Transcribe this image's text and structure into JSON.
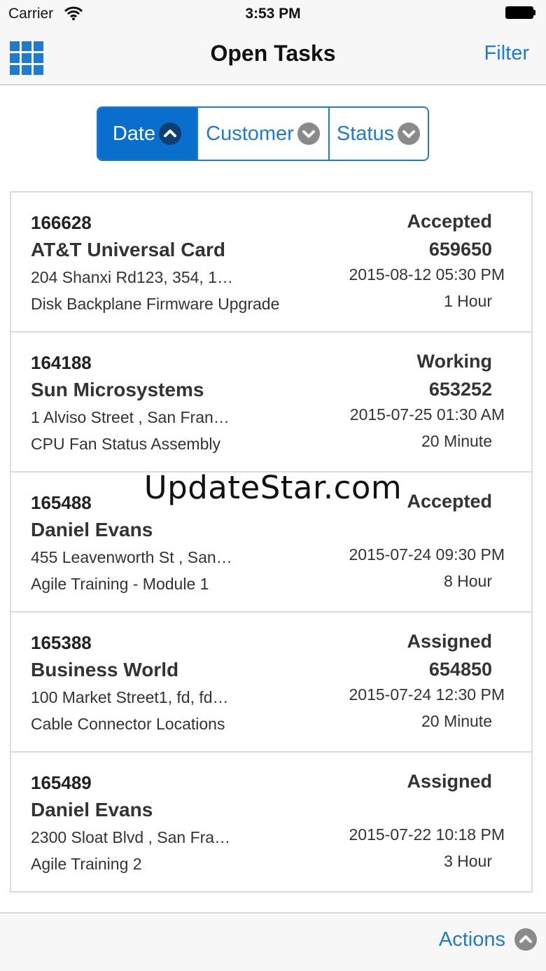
{
  "status_bar": {
    "carrier": "Carrier",
    "time": "3:53 PM"
  },
  "nav": {
    "title": "Open Tasks",
    "filter_label": "Filter"
  },
  "sort": {
    "segments": [
      {
        "label": "Date",
        "active": true,
        "direction": "up"
      },
      {
        "label": "Customer",
        "active": false,
        "direction": "down"
      },
      {
        "label": "Status",
        "active": false,
        "direction": "down"
      }
    ]
  },
  "tasks": [
    {
      "id": "166628",
      "customer": "AT&T Universal Card",
      "address": "204 Shanxi Rd123, 354, 1…",
      "description": "Disk Backplane Firmware Upgrade",
      "status": "Accepted",
      "number": "659650",
      "datetime": "2015-08-12 05:30 PM",
      "duration": "1 Hour"
    },
    {
      "id": "164188",
      "customer": "Sun Microsystems",
      "address": "1 Alviso Street , San Fran…",
      "description": "CPU Fan Status Assembly",
      "status": "Working",
      "number": "653252",
      "datetime": "2015-07-25 01:30 AM",
      "duration": "20 Minute"
    },
    {
      "id": "165488",
      "customer": "Daniel Evans",
      "address": "455 Leavenworth St , San…",
      "description": "Agile Training - Module 1",
      "status": "Accepted",
      "number": "",
      "datetime": "2015-07-24 09:30 PM",
      "duration": "8 Hour"
    },
    {
      "id": "165388",
      "customer": "Business World",
      "address": "100 Market Street1, fd, fd…",
      "description": "Cable Connector Locations",
      "status": "Assigned",
      "number": "654850",
      "datetime": "2015-07-24 12:30 PM",
      "duration": "20 Minute"
    },
    {
      "id": "165489",
      "customer": "Daniel Evans",
      "address": "2300 Sloat Blvd , San Fra…",
      "description": "Agile Training 2",
      "status": "Assigned",
      "number": "",
      "datetime": "2015-07-22 10:18 PM",
      "duration": "3 Hour"
    }
  ],
  "watermark": "UpdateStar.com",
  "footer": {
    "actions_label": "Actions"
  },
  "colors": {
    "accent": "#1f7bd0",
    "active_segment": "#0a6fcc",
    "icon_gray": "#8a8a8a"
  },
  "icons": {
    "grid": "grid-icon",
    "wifi": "wifi-icon",
    "battery": "battery-icon",
    "chevron_up": "chevron-up-circle-icon",
    "chevron_down": "chevron-down-circle-icon"
  }
}
